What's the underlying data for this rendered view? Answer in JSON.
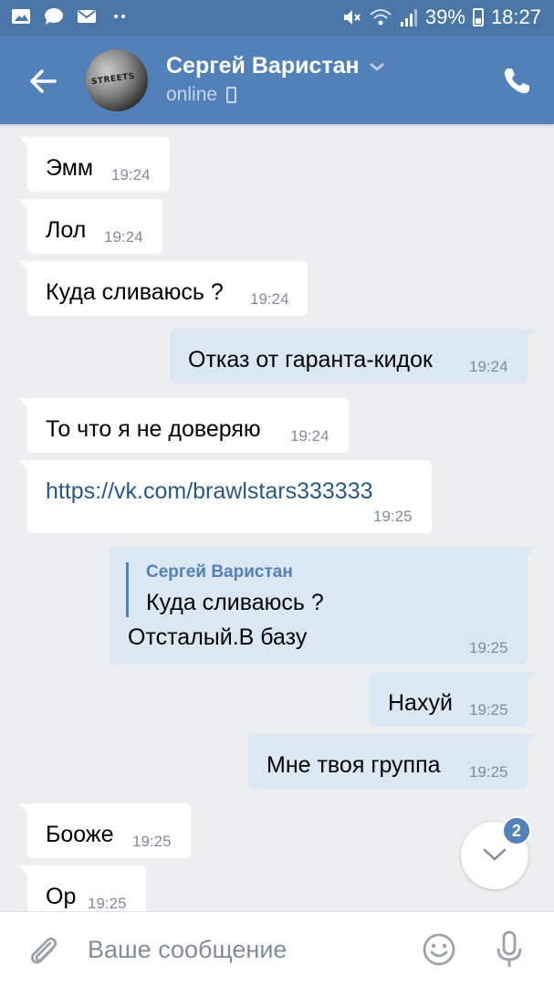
{
  "status_bar": {
    "battery": "39%",
    "time": "18:27",
    "icons": [
      "gallery-icon",
      "chat-icon",
      "mail-icon",
      "more-dots-icon",
      "mute-icon",
      "wifi-icon",
      "signal-icon",
      "battery-icon"
    ]
  },
  "header": {
    "contact_name": "Сергей Варистан",
    "status": "online",
    "avatar_text": "STREETS"
  },
  "messages": [
    {
      "dir": "in",
      "text": "Эмм",
      "time": "19:24"
    },
    {
      "dir": "in",
      "text": "Лол",
      "time": "19:24"
    },
    {
      "dir": "in",
      "text": "Куда сливаюсь ?",
      "time": "19:24"
    },
    {
      "dir": "out",
      "text": "Отказ от гаранта-кидок",
      "time": "19:24"
    },
    {
      "dir": "in",
      "text": "То что я не доверяю",
      "time": "19:24"
    },
    {
      "dir": "in",
      "text": "https://vk.com/brawlstars333333",
      "time": "19:25"
    },
    {
      "dir": "out",
      "reply_author": "Сергей Варистан",
      "reply_text": "Куда сливаюсь ?",
      "text": "Отсталый.В базу",
      "time": "19:25"
    },
    {
      "dir": "out",
      "text": "Нахуй",
      "time": "19:25"
    },
    {
      "dir": "out",
      "text": "Мне твоя группа",
      "time": "19:25"
    },
    {
      "dir": "in",
      "text": "Бооже",
      "time": "19:25"
    },
    {
      "dir": "in",
      "text": "Ор",
      "time": "19:25"
    }
  ],
  "scroll_badge": "2",
  "composer": {
    "placeholder": "Ваше сообщение"
  },
  "colors": {
    "header": "#5181b8",
    "status_bar": "#4a76a8",
    "background": "#edeef0",
    "outgoing_bubble": "#dce7f4",
    "incoming_bubble": "#ffffff",
    "link": "#2a5885"
  }
}
